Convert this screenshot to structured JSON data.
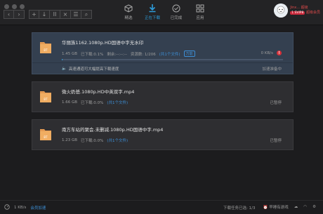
{
  "toolbar": {
    "back_icon": "chevron-left",
    "forward_icon": "chevron-right",
    "add_icon": "plus",
    "download_icon": "arrow-down",
    "pause_icon": "pause",
    "delete_icon": "close",
    "list_icon": "list",
    "search_icon": "search"
  },
  "tabs": [
    {
      "label": "精选"
    },
    {
      "label": "正在下载"
    },
    {
      "label": "已完成"
    },
    {
      "label": "应用"
    }
  ],
  "user": {
    "name": "Jinx...",
    "badge": "超级",
    "vip": "1 SVIP8",
    "svip_label": "超级会员",
    "member": "超级会员"
  },
  "downloads": [
    {
      "title": "华丽族1162.1080p.HD国语中字无水印",
      "size": "1.45 GB",
      "progress_text": "已下载:0.1%",
      "time": "剩余:--:--:--",
      "resources": "资源数: 1/206",
      "files": "(共1个文件)",
      "tag": "万能",
      "speed": "0 KB/s",
      "progress": 0.001,
      "tip": "高速通道可大幅提高下载速度",
      "accel": "加速准备中"
    },
    {
      "title": "微火奶爸.1080p.HD中英双字.mp4",
      "size": "1.66 GB",
      "progress_text": "已下载:0.0%",
      "files": "(共1个文件)",
      "status": "已暂停"
    },
    {
      "title": "南方车站的聚会.未删减.1080p.HD国语中字.mp4",
      "size": "1.23 GB",
      "progress_text": "已下载:0.0%",
      "files": "(共1个文件)",
      "status": "已暂停"
    }
  ],
  "statusbar": {
    "speed": "1 KB/s",
    "accel_link": "会员加速",
    "task_count": "下载任务已选: 1/3",
    "shutdown": "早睡有游戏",
    "accent": "#2d9cdb"
  }
}
